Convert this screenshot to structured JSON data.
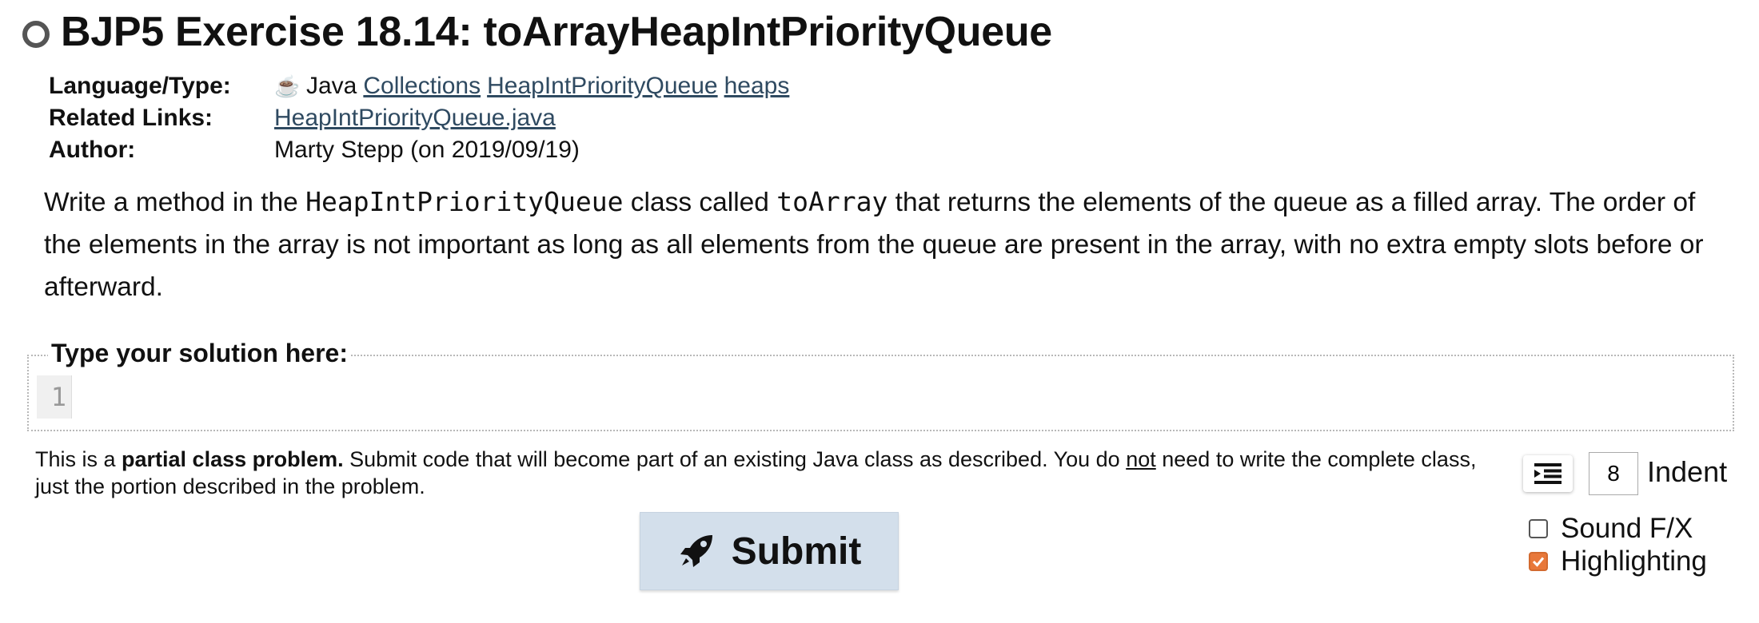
{
  "header": {
    "title": "BJP5 Exercise 18.14: toArrayHeapIntPriorityQueue"
  },
  "meta": {
    "language_label": "Language/Type:",
    "language": "Java",
    "tags": [
      "Collections",
      "HeapIntPriorityQueue",
      "heaps"
    ],
    "related_label": "Related Links:",
    "related_link": "HeapIntPriorityQueue.java",
    "author_label": "Author:",
    "author": "Marty Stepp (on 2019/09/19)"
  },
  "description": {
    "part1": "Write a method in the ",
    "code1": "HeapIntPriorityQueue",
    "part2": " class called ",
    "code2": "toArray",
    "part3": " that returns the elements of the queue as a filled array. The order of the elements in the array is not important as long as all elements from the queue are present in the array, with no extra empty slots before or afterward."
  },
  "editor": {
    "legend": "Type your solution here:",
    "line_numbers": [
      "1"
    ],
    "code": ""
  },
  "note": {
    "prefix": "This is a ",
    "bold": "partial class problem.",
    "middle": " Submit code that will become part of an existing Java class as described. You do ",
    "underlined": "not",
    "suffix": " need to write the complete class, just the portion described in the problem."
  },
  "controls": {
    "submit_label": "Submit",
    "indent_value": "8",
    "indent_label": "Indent",
    "sound_label": "Sound F/X",
    "sound_checked": false,
    "highlight_label": "Highlighting",
    "highlight_checked": true,
    "accent_color": "#e8783a"
  }
}
